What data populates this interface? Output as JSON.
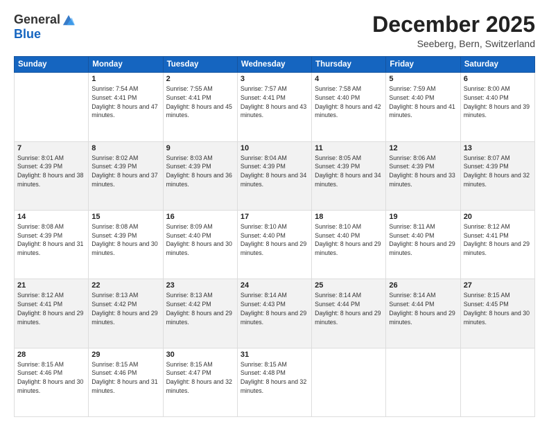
{
  "logo": {
    "general": "General",
    "blue": "Blue"
  },
  "header": {
    "month_title": "December 2025",
    "subtitle": "Seeberg, Bern, Switzerland"
  },
  "weekdays": [
    "Sunday",
    "Monday",
    "Tuesday",
    "Wednesday",
    "Thursday",
    "Friday",
    "Saturday"
  ],
  "weeks": [
    [
      {
        "day": "",
        "sunrise": "",
        "sunset": "",
        "daylight": ""
      },
      {
        "day": "1",
        "sunrise": "Sunrise: 7:54 AM",
        "sunset": "Sunset: 4:41 PM",
        "daylight": "Daylight: 8 hours and 47 minutes."
      },
      {
        "day": "2",
        "sunrise": "Sunrise: 7:55 AM",
        "sunset": "Sunset: 4:41 PM",
        "daylight": "Daylight: 8 hours and 45 minutes."
      },
      {
        "day": "3",
        "sunrise": "Sunrise: 7:57 AM",
        "sunset": "Sunset: 4:41 PM",
        "daylight": "Daylight: 8 hours and 43 minutes."
      },
      {
        "day": "4",
        "sunrise": "Sunrise: 7:58 AM",
        "sunset": "Sunset: 4:40 PM",
        "daylight": "Daylight: 8 hours and 42 minutes."
      },
      {
        "day": "5",
        "sunrise": "Sunrise: 7:59 AM",
        "sunset": "Sunset: 4:40 PM",
        "daylight": "Daylight: 8 hours and 41 minutes."
      },
      {
        "day": "6",
        "sunrise": "Sunrise: 8:00 AM",
        "sunset": "Sunset: 4:40 PM",
        "daylight": "Daylight: 8 hours and 39 minutes."
      }
    ],
    [
      {
        "day": "7",
        "sunrise": "Sunrise: 8:01 AM",
        "sunset": "Sunset: 4:39 PM",
        "daylight": "Daylight: 8 hours and 38 minutes."
      },
      {
        "day": "8",
        "sunrise": "Sunrise: 8:02 AM",
        "sunset": "Sunset: 4:39 PM",
        "daylight": "Daylight: 8 hours and 37 minutes."
      },
      {
        "day": "9",
        "sunrise": "Sunrise: 8:03 AM",
        "sunset": "Sunset: 4:39 PM",
        "daylight": "Daylight: 8 hours and 36 minutes."
      },
      {
        "day": "10",
        "sunrise": "Sunrise: 8:04 AM",
        "sunset": "Sunset: 4:39 PM",
        "daylight": "Daylight: 8 hours and 34 minutes."
      },
      {
        "day": "11",
        "sunrise": "Sunrise: 8:05 AM",
        "sunset": "Sunset: 4:39 PM",
        "daylight": "Daylight: 8 hours and 34 minutes."
      },
      {
        "day": "12",
        "sunrise": "Sunrise: 8:06 AM",
        "sunset": "Sunset: 4:39 PM",
        "daylight": "Daylight: 8 hours and 33 minutes."
      },
      {
        "day": "13",
        "sunrise": "Sunrise: 8:07 AM",
        "sunset": "Sunset: 4:39 PM",
        "daylight": "Daylight: 8 hours and 32 minutes."
      }
    ],
    [
      {
        "day": "14",
        "sunrise": "Sunrise: 8:08 AM",
        "sunset": "Sunset: 4:39 PM",
        "daylight": "Daylight: 8 hours and 31 minutes."
      },
      {
        "day": "15",
        "sunrise": "Sunrise: 8:08 AM",
        "sunset": "Sunset: 4:39 PM",
        "daylight": "Daylight: 8 hours and 30 minutes."
      },
      {
        "day": "16",
        "sunrise": "Sunrise: 8:09 AM",
        "sunset": "Sunset: 4:40 PM",
        "daylight": "Daylight: 8 hours and 30 minutes."
      },
      {
        "day": "17",
        "sunrise": "Sunrise: 8:10 AM",
        "sunset": "Sunset: 4:40 PM",
        "daylight": "Daylight: 8 hours and 29 minutes."
      },
      {
        "day": "18",
        "sunrise": "Sunrise: 8:10 AM",
        "sunset": "Sunset: 4:40 PM",
        "daylight": "Daylight: 8 hours and 29 minutes."
      },
      {
        "day": "19",
        "sunrise": "Sunrise: 8:11 AM",
        "sunset": "Sunset: 4:40 PM",
        "daylight": "Daylight: 8 hours and 29 minutes."
      },
      {
        "day": "20",
        "sunrise": "Sunrise: 8:12 AM",
        "sunset": "Sunset: 4:41 PM",
        "daylight": "Daylight: 8 hours and 29 minutes."
      }
    ],
    [
      {
        "day": "21",
        "sunrise": "Sunrise: 8:12 AM",
        "sunset": "Sunset: 4:41 PM",
        "daylight": "Daylight: 8 hours and 29 minutes."
      },
      {
        "day": "22",
        "sunrise": "Sunrise: 8:13 AM",
        "sunset": "Sunset: 4:42 PM",
        "daylight": "Daylight: 8 hours and 29 minutes."
      },
      {
        "day": "23",
        "sunrise": "Sunrise: 8:13 AM",
        "sunset": "Sunset: 4:42 PM",
        "daylight": "Daylight: 8 hours and 29 minutes."
      },
      {
        "day": "24",
        "sunrise": "Sunrise: 8:14 AM",
        "sunset": "Sunset: 4:43 PM",
        "daylight": "Daylight: 8 hours and 29 minutes."
      },
      {
        "day": "25",
        "sunrise": "Sunrise: 8:14 AM",
        "sunset": "Sunset: 4:44 PM",
        "daylight": "Daylight: 8 hours and 29 minutes."
      },
      {
        "day": "26",
        "sunrise": "Sunrise: 8:14 AM",
        "sunset": "Sunset: 4:44 PM",
        "daylight": "Daylight: 8 hours and 29 minutes."
      },
      {
        "day": "27",
        "sunrise": "Sunrise: 8:15 AM",
        "sunset": "Sunset: 4:45 PM",
        "daylight": "Daylight: 8 hours and 30 minutes."
      }
    ],
    [
      {
        "day": "28",
        "sunrise": "Sunrise: 8:15 AM",
        "sunset": "Sunset: 4:46 PM",
        "daylight": "Daylight: 8 hours and 30 minutes."
      },
      {
        "day": "29",
        "sunrise": "Sunrise: 8:15 AM",
        "sunset": "Sunset: 4:46 PM",
        "daylight": "Daylight: 8 hours and 31 minutes."
      },
      {
        "day": "30",
        "sunrise": "Sunrise: 8:15 AM",
        "sunset": "Sunset: 4:47 PM",
        "daylight": "Daylight: 8 hours and 32 minutes."
      },
      {
        "day": "31",
        "sunrise": "Sunrise: 8:15 AM",
        "sunset": "Sunset: 4:48 PM",
        "daylight": "Daylight: 8 hours and 32 minutes."
      },
      {
        "day": "",
        "sunrise": "",
        "sunset": "",
        "daylight": ""
      },
      {
        "day": "",
        "sunrise": "",
        "sunset": "",
        "daylight": ""
      },
      {
        "day": "",
        "sunrise": "",
        "sunset": "",
        "daylight": ""
      }
    ]
  ]
}
